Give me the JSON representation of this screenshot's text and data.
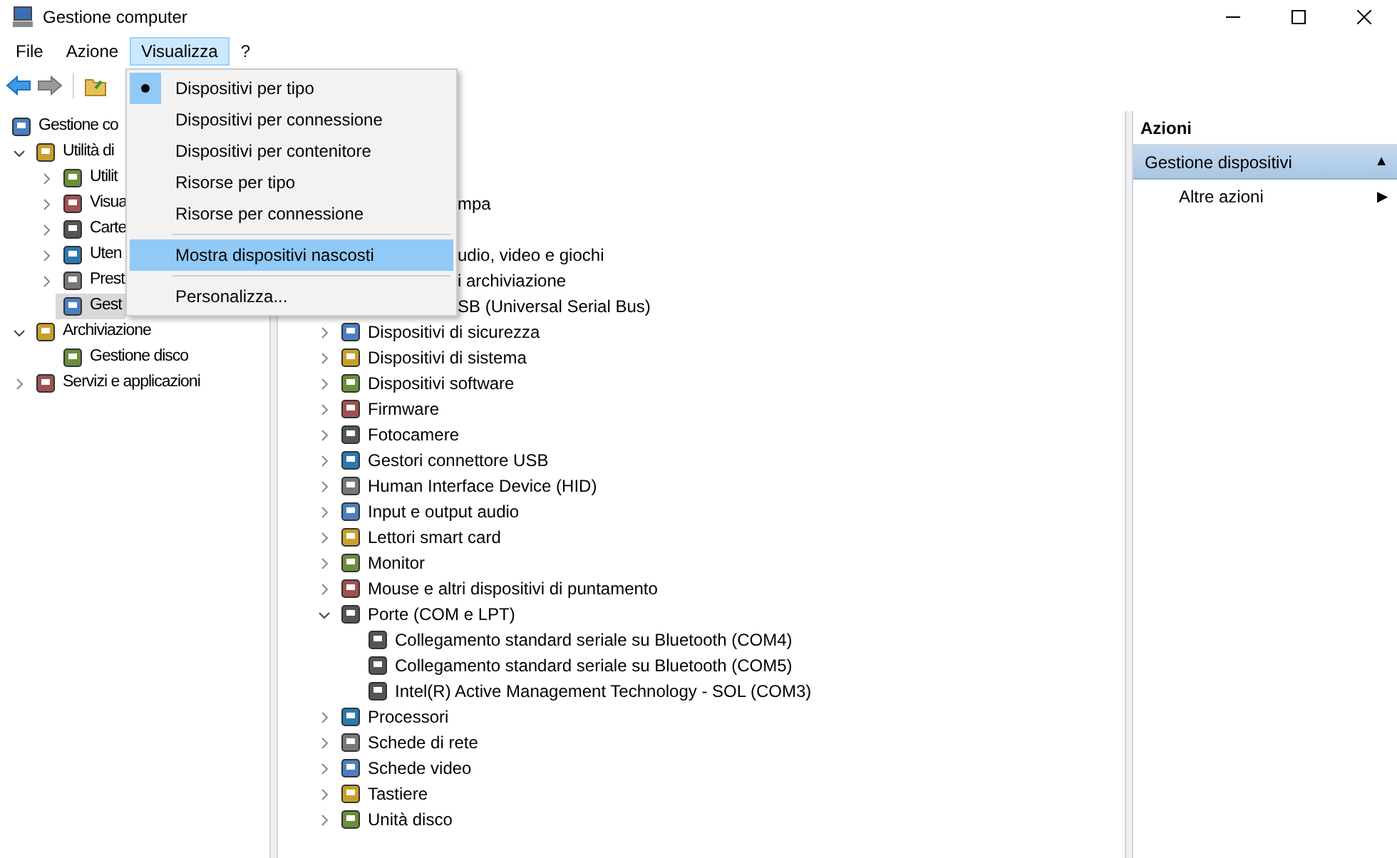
{
  "window": {
    "title": "Gestione computer"
  },
  "menubar": [
    {
      "label": "File",
      "selected": false
    },
    {
      "label": "Azione",
      "selected": false
    },
    {
      "label": "Visualizza",
      "selected": true
    },
    {
      "label": "?",
      "selected": false
    }
  ],
  "open_menu": {
    "items": [
      {
        "kind": "radio",
        "label": "Dispositivi per tipo",
        "checked": true,
        "highlighted": false
      },
      {
        "kind": "radio",
        "label": "Dispositivi per connessione",
        "checked": false,
        "highlighted": false
      },
      {
        "kind": "radio",
        "label": "Dispositivi per contenitore",
        "checked": false,
        "highlighted": false
      },
      {
        "kind": "radio",
        "label": "Risorse per tipo",
        "checked": false,
        "highlighted": false
      },
      {
        "kind": "radio",
        "label": "Risorse per connessione",
        "checked": false,
        "highlighted": false
      },
      {
        "kind": "separator"
      },
      {
        "kind": "command",
        "label": "Mostra dispositivi nascosti",
        "highlighted": true
      },
      {
        "kind": "separator"
      },
      {
        "kind": "command",
        "label": "Personalizza...",
        "highlighted": false
      }
    ]
  },
  "nav_tree": [
    {
      "label": "Gestione co",
      "selected": false,
      "children": [
        {
          "label": "Utilità di",
          "expanded": true,
          "selected": false,
          "children": [
            {
              "label": "Utilit",
              "expanded": false,
              "selected": false
            },
            {
              "label": "Visua",
              "expanded": false,
              "selected": false
            },
            {
              "label": "Carte",
              "expanded": false,
              "selected": false
            },
            {
              "label": "Uten",
              "expanded": false,
              "selected": false
            },
            {
              "label": "Prest",
              "expanded": false,
              "selected": false
            },
            {
              "label": "Gest",
              "selected": true
            }
          ]
        },
        {
          "label": "Archiviazione",
          "expanded": true,
          "selected": false,
          "children": [
            {
              "label": "Gestione disco",
              "selected": false
            }
          ]
        },
        {
          "label": "Servizi e applicazioni",
          "expanded": false,
          "selected": false
        }
      ]
    }
  ],
  "device_tree": {
    "partial_items": [
      "mpa",
      "udio, video e giochi",
      "i archiviazione",
      "SB (Universal Serial Bus)"
    ],
    "items": [
      {
        "label": "Dispositivi di sicurezza",
        "expanded": false
      },
      {
        "label": "Dispositivi di sistema",
        "expanded": false
      },
      {
        "label": "Dispositivi software",
        "expanded": false
      },
      {
        "label": "Firmware",
        "expanded": false
      },
      {
        "label": "Fotocamere",
        "expanded": false
      },
      {
        "label": "Gestori connettore USB",
        "expanded": false
      },
      {
        "label": "Human Interface Device (HID)",
        "expanded": false
      },
      {
        "label": "Input e output audio",
        "expanded": false
      },
      {
        "label": "Lettori smart card",
        "expanded": false
      },
      {
        "label": "Monitor",
        "expanded": false
      },
      {
        "label": "Mouse e altri dispositivi di puntamento",
        "expanded": false
      },
      {
        "label": "Porte (COM e LPT)",
        "expanded": true,
        "children": [
          {
            "label": "Collegamento standard seriale su Bluetooth (COM4)"
          },
          {
            "label": "Collegamento standard seriale su Bluetooth (COM5)"
          },
          {
            "label": "Intel(R) Active Management Technology - SOL (COM3)"
          }
        ]
      },
      {
        "label": "Processori",
        "expanded": false
      },
      {
        "label": "Schede di rete",
        "expanded": false
      },
      {
        "label": "Schede video",
        "expanded": false
      },
      {
        "label": "Tastiere",
        "expanded": false
      },
      {
        "label": "Unità disco",
        "expanded": false
      }
    ]
  },
  "actions": {
    "title": "Azioni",
    "section": {
      "label": "Gestione dispositivi",
      "glyph": "▲"
    },
    "items": [
      {
        "label": "Altre azioni",
        "glyph": "▶"
      }
    ]
  }
}
